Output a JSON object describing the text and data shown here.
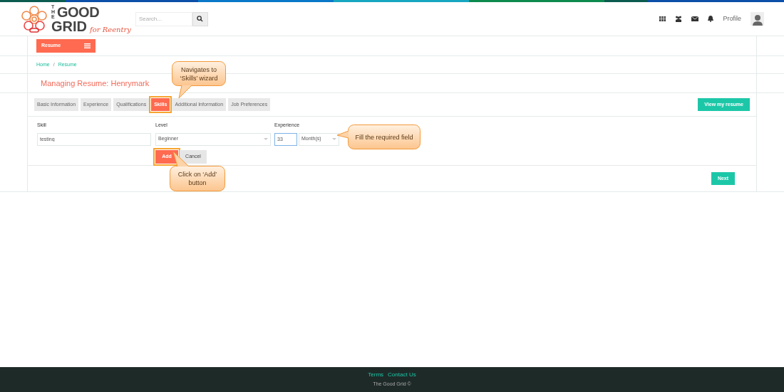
{
  "logo": {
    "the": "THE",
    "good": "GOOD",
    "grid": "GRID",
    "tagline": "for Reentry"
  },
  "search": {
    "placeholder": "Search..."
  },
  "nav": {
    "profile": "Profile"
  },
  "menu_button": "Resume",
  "breadcrumb": [
    "Home",
    "Resume"
  ],
  "breadcrumb_separator": "/",
  "page_title": "Managing Resume: Henrymark",
  "tabs": [
    {
      "label": "Basic Information",
      "selected": false
    },
    {
      "label": "Experience",
      "selected": false
    },
    {
      "label": "Qualifications",
      "selected": false
    },
    {
      "label": "Skills",
      "selected": true
    },
    {
      "label": "Additional Information",
      "selected": false
    },
    {
      "label": "Job Preferences",
      "selected": false
    }
  ],
  "view_button": "View my resume",
  "form": {
    "skill_label": "Skill",
    "skill_value": "testing",
    "level_label": "Level",
    "level_value": "Beginner",
    "experience_label": "Experience",
    "experience_value": "33",
    "unit_value": "Month(s)",
    "add_button": "Add",
    "cancel_button": "Cancel"
  },
  "next_button": "Next",
  "callouts": [
    {
      "text": "Navigates to ‘Skills’ wizard",
      "kind": "down"
    },
    {
      "text": "Fill the required field",
      "kind": "left"
    },
    {
      "text": "Click on ‘Add’ button",
      "kind": "up"
    }
  ],
  "footer": {
    "links": [
      "Terms",
      "Contact Us"
    ],
    "copyright": "The Good Grid ©"
  }
}
